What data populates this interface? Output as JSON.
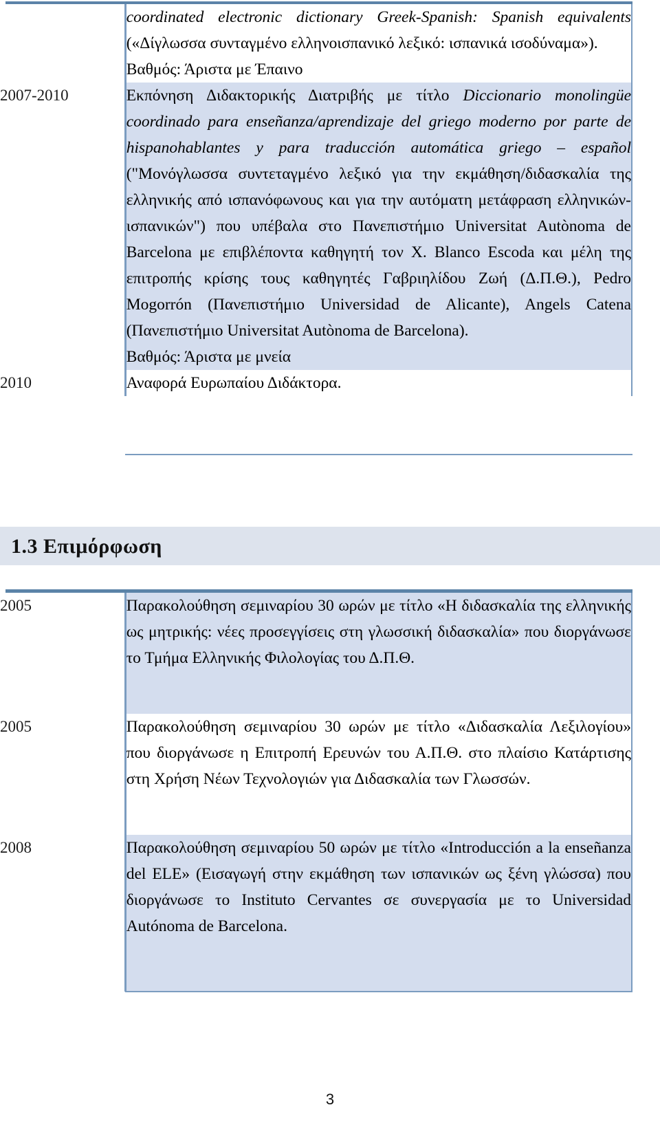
{
  "document": {
    "page_number": "3",
    "colors": {
      "rule": "#5b83a8",
      "cell_border": "#7b9cc0",
      "shaded_row": "#d4ddee",
      "heading_band": "#dde3ed"
    }
  },
  "table_education": {
    "rows": [
      {
        "year": "",
        "shaded": false,
        "paragraphs": [
          {
            "italic_lead": "coordinated electronic dictionary Greek-Spanish: Spanish equivalents",
            "text": " («Δίγλωσσα συνταγμένο ελληνοισπανικό λεξικό: ισπανικά ισοδύναμα»)."
          },
          {
            "italic_lead": "",
            "text": "Βαθμός: Άριστα με Έπαινο"
          }
        ]
      },
      {
        "year": "2007-2010",
        "shaded": true,
        "paragraphs": [
          {
            "italic_lead": "",
            "text": "Εκπόνηση Διδακτορικής Διατριβής με τίτλο "
          },
          {
            "italic_lead": "Diccionario monolingüe coordinado para enseñanza/aprendizaje del griego moderno por parte de hispanohablantes y para traducción automática griego – español",
            "text": " (\"Μονόγλωσσα συντεταγμένο λεξικό για την εκμάθηση/διδασκαλία της ελληνικής από ισπανόφωνους και για την αυτόματη μετάφραση ελληνικών-ισπανικών\") που υπέβαλα στο Πανεπιστήμιο Universitat Autònoma de Barcelona με επιβλέποντα καθηγητή     τον Χ. Blanco Escoda και μέλη της επιτροπής κρίσης τους καθηγητές Γαβριηλίδου Ζωή (Δ.Π.Θ.), Pedro Mogorrón      (Πανεπιστήμιο Universidad de Alicante), Angels Catena (Πανεπιστήμιο Universitat Autònoma de Barcelona)."
          },
          {
            "italic_lead": "",
            "text": "Βαθμός: Άριστα με μνεία"
          }
        ]
      },
      {
        "year": "2010",
        "shaded": false,
        "paragraphs": [
          {
            "italic_lead": "",
            "text": "Αναφορά Ευρωπαίου Διδάκτορα."
          }
        ]
      }
    ]
  },
  "section": {
    "number_and_title": "1.3 Επιμόρφωση"
  },
  "table_training": {
    "rows": [
      {
        "year": "2005",
        "shaded": true,
        "paragraphs": [
          {
            "italic_lead": "",
            "text": "Παρακολούθηση σεμιναρίου 30 ωρών με τίτλο «Η διδασκαλία της ελληνικής ως μητρικής: νέες προσεγγίσεις στη γλωσσική διδασκαλία» που διοργάνωσε το Τμήμα Ελληνικής Φιλολογίας του Δ.Π.Θ."
          }
        ]
      },
      {
        "year": "2005",
        "shaded": false,
        "paragraphs": [
          {
            "italic_lead": "",
            "text": "Παρακολούθηση σεμιναρίου 30 ωρών με τίτλο «Διδασκαλία Λεξιλογίου» που διοργάνωσε η Επιτροπή Ερευνών του Α.Π.Θ. στο πλαίσιο Κατάρτισης στη Χρήση Νέων Τεχνολογιών για Διδασκαλία των Γλωσσών."
          }
        ]
      },
      {
        "year": "2008",
        "shaded": true,
        "paragraphs": [
          {
            "italic_lead": "",
            "text": "Παρακολούθηση σεμιναρίου 50 ωρών με τίτλο «Introducción a la enseñanza del ELE» (Εισαγωγή στην εκμάθηση των ισπανικών ως ξένη γλώσσα) που διοργάνωσε το Instituto Cervantes σε συνεργασία με το Universidad Autónoma de Barcelona."
          }
        ]
      }
    ]
  }
}
